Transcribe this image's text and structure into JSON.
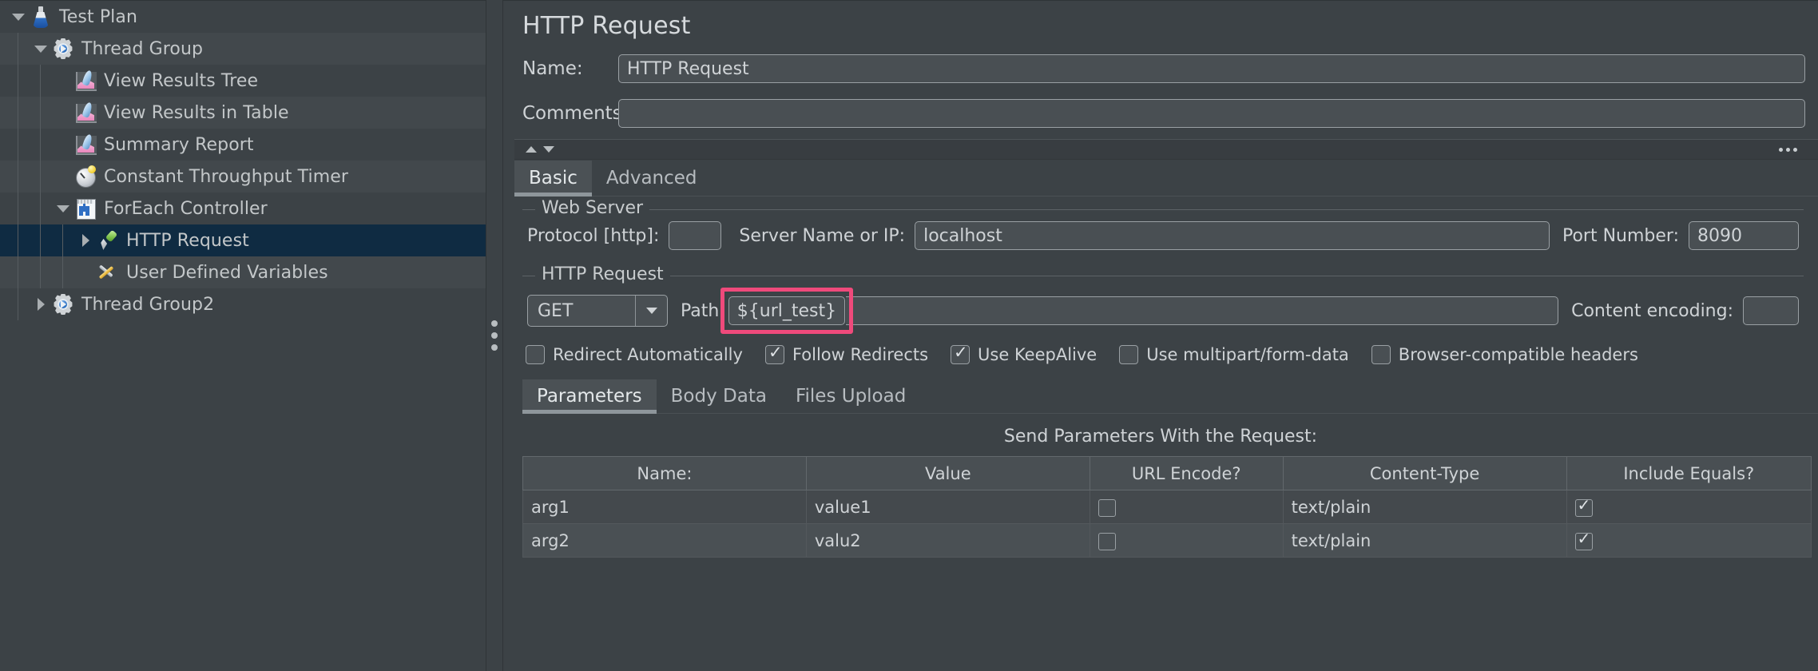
{
  "tree": {
    "items": [
      {
        "label": "Test Plan",
        "icon": "flask-icon",
        "depth": 0,
        "twisty": "open",
        "selected": false,
        "alt": false
      },
      {
        "label": "Thread Group",
        "icon": "gear-icon",
        "depth": 1,
        "twisty": "open",
        "selected": false,
        "alt": true
      },
      {
        "label": "View Results Tree",
        "icon": "chart-icon",
        "depth": 2,
        "twisty": "none",
        "selected": false,
        "alt": false
      },
      {
        "label": "View Results in Table",
        "icon": "chart-icon",
        "depth": 2,
        "twisty": "none",
        "selected": false,
        "alt": true
      },
      {
        "label": "Summary Report",
        "icon": "chart-icon",
        "depth": 2,
        "twisty": "none",
        "selected": false,
        "alt": false
      },
      {
        "label": "Constant Throughput Timer",
        "icon": "timer-icon",
        "depth": 2,
        "twisty": "none",
        "selected": false,
        "alt": true
      },
      {
        "label": "ForEach Controller",
        "icon": "controller-icon",
        "depth": 2,
        "twisty": "open",
        "selected": false,
        "alt": false
      },
      {
        "label": "HTTP Request",
        "icon": "pipette-icon",
        "depth": 3,
        "twisty": "closed",
        "selected": true,
        "alt": false
      },
      {
        "label": "User Defined Variables",
        "icon": "tools-icon",
        "depth": 3,
        "twisty": "none",
        "selected": false,
        "alt": true
      },
      {
        "label": "Thread Group2",
        "icon": "gear-icon",
        "depth": 1,
        "twisty": "closed",
        "selected": false,
        "alt": false
      }
    ]
  },
  "panel": {
    "title": "HTTP Request",
    "name_label": "Name:",
    "name_value": "HTTP Request",
    "comments_label": "Comments:",
    "comments_value": "",
    "tabs": [
      {
        "label": "Basic",
        "active": true
      },
      {
        "label": "Advanced",
        "active": false
      }
    ],
    "web_server": {
      "section_title": "Web Server",
      "protocol_label": "Protocol [http]:",
      "protocol_value": "",
      "server_label": "Server Name or IP:",
      "server_value": "localhost",
      "port_label": "Port Number:",
      "port_value": "8090"
    },
    "http_request": {
      "section_title": "HTTP Request",
      "method_value": "GET",
      "path_label": "Path:",
      "path_value": "${url_test}",
      "encoding_label": "Content encoding:",
      "encoding_value": "",
      "highlight_color": "#ef4a7b"
    },
    "checkboxes": [
      {
        "label": "Redirect Automatically",
        "checked": false
      },
      {
        "label": "Follow Redirects",
        "checked": true
      },
      {
        "label": "Use KeepAlive",
        "checked": true
      },
      {
        "label": "Use multipart/form-data",
        "checked": false
      },
      {
        "label": "Browser-compatible headers",
        "checked": false
      }
    ],
    "sub_tabs": [
      {
        "label": "Parameters",
        "active": true
      },
      {
        "label": "Body Data",
        "active": false
      },
      {
        "label": "Files Upload",
        "active": false
      }
    ],
    "params_title": "Send Parameters With the Request:",
    "params_table": {
      "columns": [
        "Name:",
        "Value",
        "URL Encode?",
        "Content-Type",
        "Include Equals?"
      ],
      "rows": [
        {
          "name": "arg1",
          "value": "value1",
          "url_encode": false,
          "content_type": "text/plain",
          "include_equals": true
        },
        {
          "name": "arg2",
          "value": "valu2",
          "url_encode": false,
          "content_type": "text/plain",
          "include_equals": true
        }
      ]
    }
  },
  "theme": {
    "bg": "#3c4246",
    "selected_row": "#0f2b42",
    "accent_pink": "#ef4a7b"
  }
}
